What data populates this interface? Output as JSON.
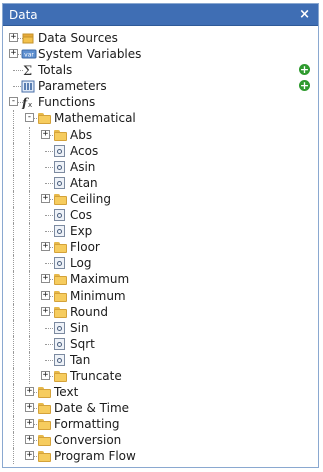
{
  "panel": {
    "title": "Data",
    "close_glyph": "×"
  },
  "tree": [
    {
      "label": "Data Sources",
      "icon": "datasource-icon",
      "level": 0,
      "expander": "+",
      "lines": []
    },
    {
      "label": "System Variables",
      "icon": "variable-icon",
      "level": 0,
      "expander": "+",
      "lines": []
    },
    {
      "label": "Totals",
      "icon": "sigma-icon",
      "level": 0,
      "expander": "",
      "add": "+",
      "lines": []
    },
    {
      "label": "Parameters",
      "icon": "parameters-icon",
      "level": 0,
      "expander": "",
      "add": "+",
      "lines": []
    },
    {
      "label": "Functions",
      "icon": "function-icon",
      "level": 0,
      "expander": "-",
      "lines": []
    },
    {
      "label": "Mathematical",
      "icon": "folder-icon",
      "level": 1,
      "expander": "-",
      "lines": [
        0
      ]
    },
    {
      "label": "Abs",
      "icon": "folder-icon",
      "level": 2,
      "expander": "+",
      "lines": [
        0,
        1
      ]
    },
    {
      "label": "Acos",
      "icon": "function-item-icon",
      "level": 2,
      "expander": "",
      "lines": [
        0,
        1
      ]
    },
    {
      "label": "Asin",
      "icon": "function-item-icon",
      "level": 2,
      "expander": "",
      "lines": [
        0,
        1
      ]
    },
    {
      "label": "Atan",
      "icon": "function-item-icon",
      "level": 2,
      "expander": "",
      "lines": [
        0,
        1
      ]
    },
    {
      "label": "Ceiling",
      "icon": "folder-icon",
      "level": 2,
      "expander": "+",
      "lines": [
        0,
        1
      ]
    },
    {
      "label": "Cos",
      "icon": "function-item-icon",
      "level": 2,
      "expander": "",
      "lines": [
        0,
        1
      ]
    },
    {
      "label": "Exp",
      "icon": "function-item-icon",
      "level": 2,
      "expander": "",
      "lines": [
        0,
        1
      ]
    },
    {
      "label": "Floor",
      "icon": "folder-icon",
      "level": 2,
      "expander": "+",
      "lines": [
        0,
        1
      ]
    },
    {
      "label": "Log",
      "icon": "function-item-icon",
      "level": 2,
      "expander": "",
      "lines": [
        0,
        1
      ]
    },
    {
      "label": "Maximum",
      "icon": "folder-icon",
      "level": 2,
      "expander": "+",
      "lines": [
        0,
        1
      ]
    },
    {
      "label": "Minimum",
      "icon": "folder-icon",
      "level": 2,
      "expander": "+",
      "lines": [
        0,
        1
      ]
    },
    {
      "label": "Round",
      "icon": "folder-icon",
      "level": 2,
      "expander": "+",
      "lines": [
        0,
        1
      ]
    },
    {
      "label": "Sin",
      "icon": "function-item-icon",
      "level": 2,
      "expander": "",
      "lines": [
        0,
        1
      ]
    },
    {
      "label": "Sqrt",
      "icon": "function-item-icon",
      "level": 2,
      "expander": "",
      "lines": [
        0,
        1
      ]
    },
    {
      "label": "Tan",
      "icon": "function-item-icon",
      "level": 2,
      "expander": "",
      "lines": [
        0,
        1
      ]
    },
    {
      "label": "Truncate",
      "icon": "folder-icon",
      "level": 2,
      "expander": "+",
      "lines": [
        0,
        1
      ]
    },
    {
      "label": "Text",
      "icon": "folder-icon",
      "level": 1,
      "expander": "+",
      "lines": [
        0
      ]
    },
    {
      "label": "Date & Time",
      "icon": "folder-icon",
      "level": 1,
      "expander": "+",
      "lines": [
        0
      ]
    },
    {
      "label": "Formatting",
      "icon": "folder-icon",
      "level": 1,
      "expander": "+",
      "lines": [
        0
      ]
    },
    {
      "label": "Conversion",
      "icon": "folder-icon",
      "level": 1,
      "expander": "+",
      "lines": [
        0
      ]
    },
    {
      "label": "Program Flow",
      "icon": "folder-icon",
      "level": 1,
      "expander": "+",
      "lines": [
        0
      ]
    }
  ],
  "colors": {
    "titlebar": "#3f6eb4",
    "add_button": "#2e9a2e",
    "folder": "#f6cc5e"
  }
}
